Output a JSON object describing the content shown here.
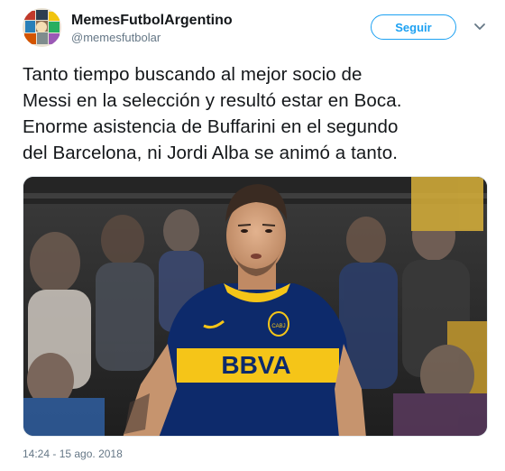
{
  "author": {
    "display_name": "MemesFutbolArgentino",
    "handle": "@memesfutbolar",
    "avatar_icon": "avatar-collage-icon"
  },
  "actions": {
    "follow_label": "Seguir",
    "menu_icon": "chevron-down-icon"
  },
  "tweet": {
    "text_lines": [
      "Tanto tiempo buscando al mejor socio de",
      "Messi en la selección y resultó estar en Boca.",
      "Enorme asistencia de Buffarini en el segundo",
      "del Barcelona, ni Jordi Alba se animó a tanto."
    ],
    "jersey_sponsor": "BBVA",
    "badge_text": "CABJ"
  },
  "meta": {
    "timestamp": "14:24 - 15 ago. 2018"
  },
  "colors": {
    "accent": "#1da1f2",
    "jersey_blue": "#0d2a6b",
    "jersey_yellow": "#f5c518"
  }
}
